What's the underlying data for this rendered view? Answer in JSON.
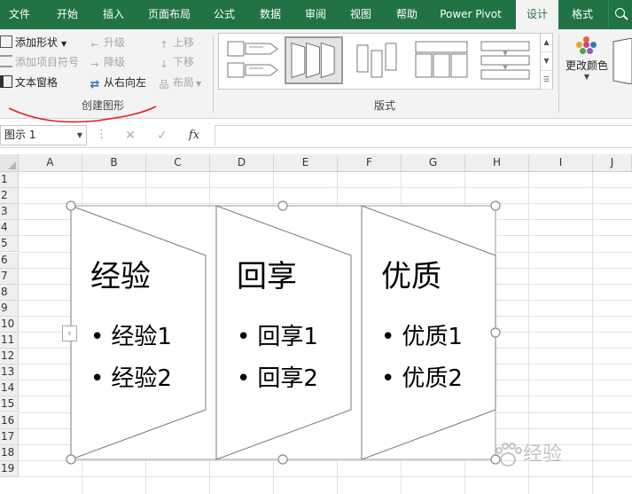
{
  "ribbon_tabs": [
    {
      "label": "文件",
      "active": false
    },
    {
      "label": "开始",
      "active": false
    },
    {
      "label": "插入",
      "active": false
    },
    {
      "label": "页面布局",
      "active": false
    },
    {
      "label": "公式",
      "active": false
    },
    {
      "label": "数据",
      "active": false
    },
    {
      "label": "审阅",
      "active": false
    },
    {
      "label": "视图",
      "active": false
    },
    {
      "label": "帮助",
      "active": false
    },
    {
      "label": "Power Pivot",
      "active": false
    },
    {
      "label": "设计",
      "active": true
    },
    {
      "label": "格式",
      "active": false
    }
  ],
  "create_graphic": {
    "add_shape": "添加形状",
    "add_bullet": "添加项目符号",
    "text_pane": "文本窗格",
    "promote": "升级",
    "demote": "降级",
    "right_to_left": "从右向左",
    "move_up": "上移",
    "move_down": "下移",
    "layout": "布局",
    "group_label": "创建图形"
  },
  "layouts": {
    "group_label": "版式"
  },
  "change_colors": {
    "label": "更改颜色"
  },
  "formula_bar": {
    "name_box": "图示 1",
    "cancel_symbol": "✕",
    "enter_symbol": "✓",
    "fx_symbol": "fx",
    "value": ""
  },
  "columns": [
    "A",
    "B",
    "C",
    "D",
    "E",
    "F",
    "G",
    "H",
    "I",
    "J"
  ],
  "rows": [
    "1",
    "2",
    "3",
    "4",
    "5",
    "6",
    "7",
    "8",
    "9",
    "10",
    "11",
    "12",
    "13",
    "14",
    "15",
    "16",
    "17",
    "18",
    "19"
  ],
  "smartart": {
    "shapes": [
      {
        "title": "经验",
        "bullets": [
          "经验1",
          "经验2"
        ]
      },
      {
        "title": "回享",
        "bullets": [
          "回享1",
          "回享2"
        ]
      },
      {
        "title": "优质",
        "bullets": [
          "优质1",
          "优质2"
        ]
      }
    ],
    "text_pane_toggle": "‹"
  },
  "watermark": "经验",
  "colors": {
    "ribbon_green": "#217346",
    "annotation_red": "#e02020",
    "color_dots": [
      "#e8613c",
      "#f0a030",
      "#2d7fc1",
      "#4aa84a",
      "#8c5cc0",
      "#d04090"
    ]
  },
  "icons": {
    "search": "search-icon",
    "add_shape": "add-shape-icon",
    "add_bullet": "add-bullet-icon",
    "text_pane": "text-pane-icon",
    "promote": "arrow-left-icon",
    "demote": "arrow-right-icon",
    "right_to_left": "swap-icon",
    "move_up": "arrow-up-icon",
    "move_down": "arrow-down-icon",
    "layout": "layout-icon"
  }
}
